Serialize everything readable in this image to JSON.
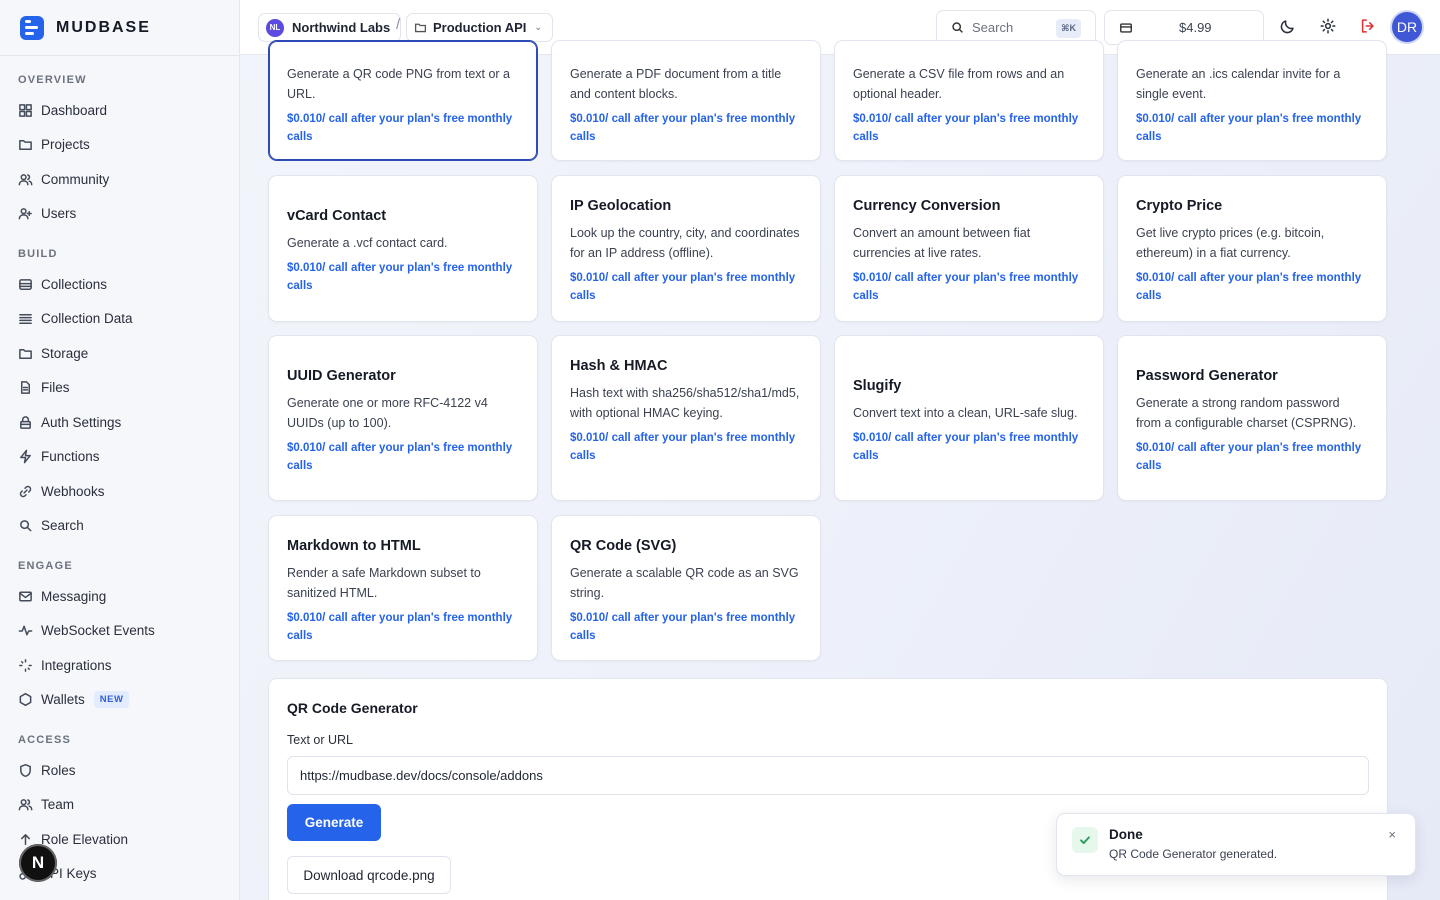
{
  "brand": {
    "name": "MUDBASE"
  },
  "sidebar": {
    "sections": [
      {
        "heading": "OVERVIEW",
        "items": [
          {
            "label": "Dashboard",
            "icon": "grid-icon"
          },
          {
            "label": "Projects",
            "icon": "folder-icon"
          },
          {
            "label": "Community",
            "icon": "users-icon"
          },
          {
            "label": "Users",
            "icon": "user-icon"
          }
        ]
      },
      {
        "heading": "BUILD",
        "items": [
          {
            "label": "Collections",
            "icon": "database-icon"
          },
          {
            "label": "Collection Data",
            "icon": "list-icon"
          },
          {
            "label": "Storage",
            "icon": "folder-icon"
          },
          {
            "label": "Files",
            "icon": "file-icon"
          },
          {
            "label": "Auth Settings",
            "icon": "lock-icon"
          },
          {
            "label": "Functions",
            "icon": "bolt-icon"
          },
          {
            "label": "Webhooks",
            "icon": "link-icon"
          },
          {
            "label": "Search",
            "icon": "search-icon"
          }
        ]
      },
      {
        "heading": "ENGAGE",
        "items": [
          {
            "label": "Messaging",
            "icon": "mail-icon"
          },
          {
            "label": "WebSocket Events",
            "icon": "activity-icon"
          },
          {
            "label": "Integrations",
            "icon": "plug-icon"
          },
          {
            "label": "Wallets",
            "icon": "hexagon-icon",
            "badge": "NEW"
          }
        ]
      },
      {
        "heading": "ACCESS",
        "items": [
          {
            "label": "Roles",
            "icon": "shield-icon"
          },
          {
            "label": "Team",
            "icon": "users-icon"
          },
          {
            "label": "Role Elevation",
            "icon": "arrow-up-icon"
          },
          {
            "label": "API Keys",
            "icon": "key-icon"
          }
        ]
      }
    ],
    "floating_badge": "N"
  },
  "topbar": {
    "org_initials": "NL",
    "org_name": "Northwind Labs",
    "separator": "/",
    "project_name": "Production API",
    "search_placeholder": "Search",
    "search_shortcut": "⌘K",
    "credits": "$4.99",
    "user_initials": "DR"
  },
  "cards": [
    {
      "title": "",
      "desc": "Generate a QR code PNG from text or a URL.",
      "price": "$0.010/ call after your plan's free monthly calls",
      "selected": true
    },
    {
      "title": "",
      "desc": "Generate a PDF document from a title and content blocks.",
      "price": "$0.010/ call after your plan's free monthly calls"
    },
    {
      "title": "",
      "desc": "Generate a CSV file from rows and an optional header.",
      "price": "$0.010/ call after your plan's free monthly calls"
    },
    {
      "title": "",
      "desc": "Generate an .ics calendar invite for a single event.",
      "price": "$0.010/ call after your plan's free monthly calls"
    },
    {
      "title": "vCard Contact",
      "desc": "Generate a .vcf contact card.",
      "price": "$0.010/ call after your plan's free monthly calls"
    },
    {
      "title": "IP Geolocation",
      "desc": "Look up the country, city, and coordinates for an IP address (offline).",
      "price": "$0.010/ call after your plan's free monthly calls"
    },
    {
      "title": "Currency Conversion",
      "desc": "Convert an amount between fiat currencies at live rates.",
      "price": "$0.010/ call after your plan's free monthly calls"
    },
    {
      "title": "Crypto Price",
      "desc": "Get live crypto prices (e.g. bitcoin, ethereum) in a fiat currency.",
      "price": "$0.010/ call after your plan's free monthly calls"
    },
    {
      "title": "UUID Generator",
      "desc": "Generate one or more RFC-4122 v4 UUIDs (up to 100).",
      "price": "$0.010/ call after your plan's free monthly calls"
    },
    {
      "title": "Hash & HMAC",
      "desc": "Hash text with sha256/sha512/sha1/md5, with optional HMAC keying.",
      "price": "$0.010/ call after your plan's free monthly calls"
    },
    {
      "title": "Slugify",
      "desc": "Convert text into a clean, URL-safe slug.",
      "price": "$0.010/ call after your plan's free monthly calls"
    },
    {
      "title": "Password Generator",
      "desc": "Generate a strong random password from a configurable charset (CSPRNG).",
      "price": "$0.010/ call after your plan's free monthly calls"
    },
    {
      "title": "Markdown to HTML",
      "desc": "Render a safe Markdown subset to sanitized HTML.",
      "price": "$0.010/ call after your plan's free monthly calls"
    },
    {
      "title": "QR Code (SVG)",
      "desc": "Generate a scalable QR code as an SVG string.",
      "price": "$0.010/ call after your plan's free monthly calls"
    }
  ],
  "panel": {
    "title": "QR Code Generator",
    "field_label": "Text or URL",
    "field_value": "https://mudbase.dev/docs/console/addons",
    "generate_label": "Generate",
    "download_label": "Download qrcode.png"
  },
  "toast": {
    "title": "Done",
    "message": "QR Code Generator generated.",
    "close": "×"
  }
}
